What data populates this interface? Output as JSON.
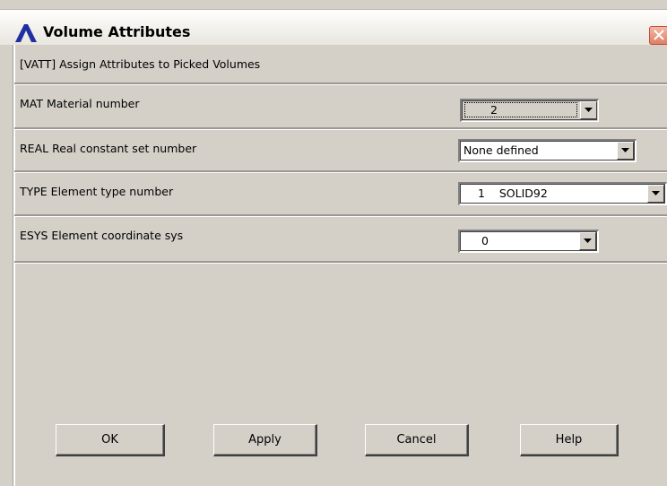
{
  "window": {
    "title": "Volume Attributes"
  },
  "header": {
    "label": "[VATT]  Assign Attributes to Picked Volumes"
  },
  "fields": {
    "mat": {
      "label": "MAT   Material number",
      "value": "2"
    },
    "real": {
      "label": "REAL  Real constant set number",
      "value": "None defined"
    },
    "type": {
      "label": "TYPE  Element type number",
      "value": "1    SOLID92"
    },
    "esys": {
      "label": "ESYS  Element coordinate sys",
      "value": "0"
    }
  },
  "buttons": {
    "ok": "OK",
    "apply": "Apply",
    "cancel": "Cancel",
    "help": "Help"
  },
  "colors": {
    "dialog_bg": "#d4d0c8",
    "logo_blue": "#1f2f9f",
    "close_red": "#e07e66"
  },
  "icons": {
    "logo": "ansys-lambda-icon",
    "close": "close-icon",
    "dropdown": "chevron-down-icon"
  }
}
